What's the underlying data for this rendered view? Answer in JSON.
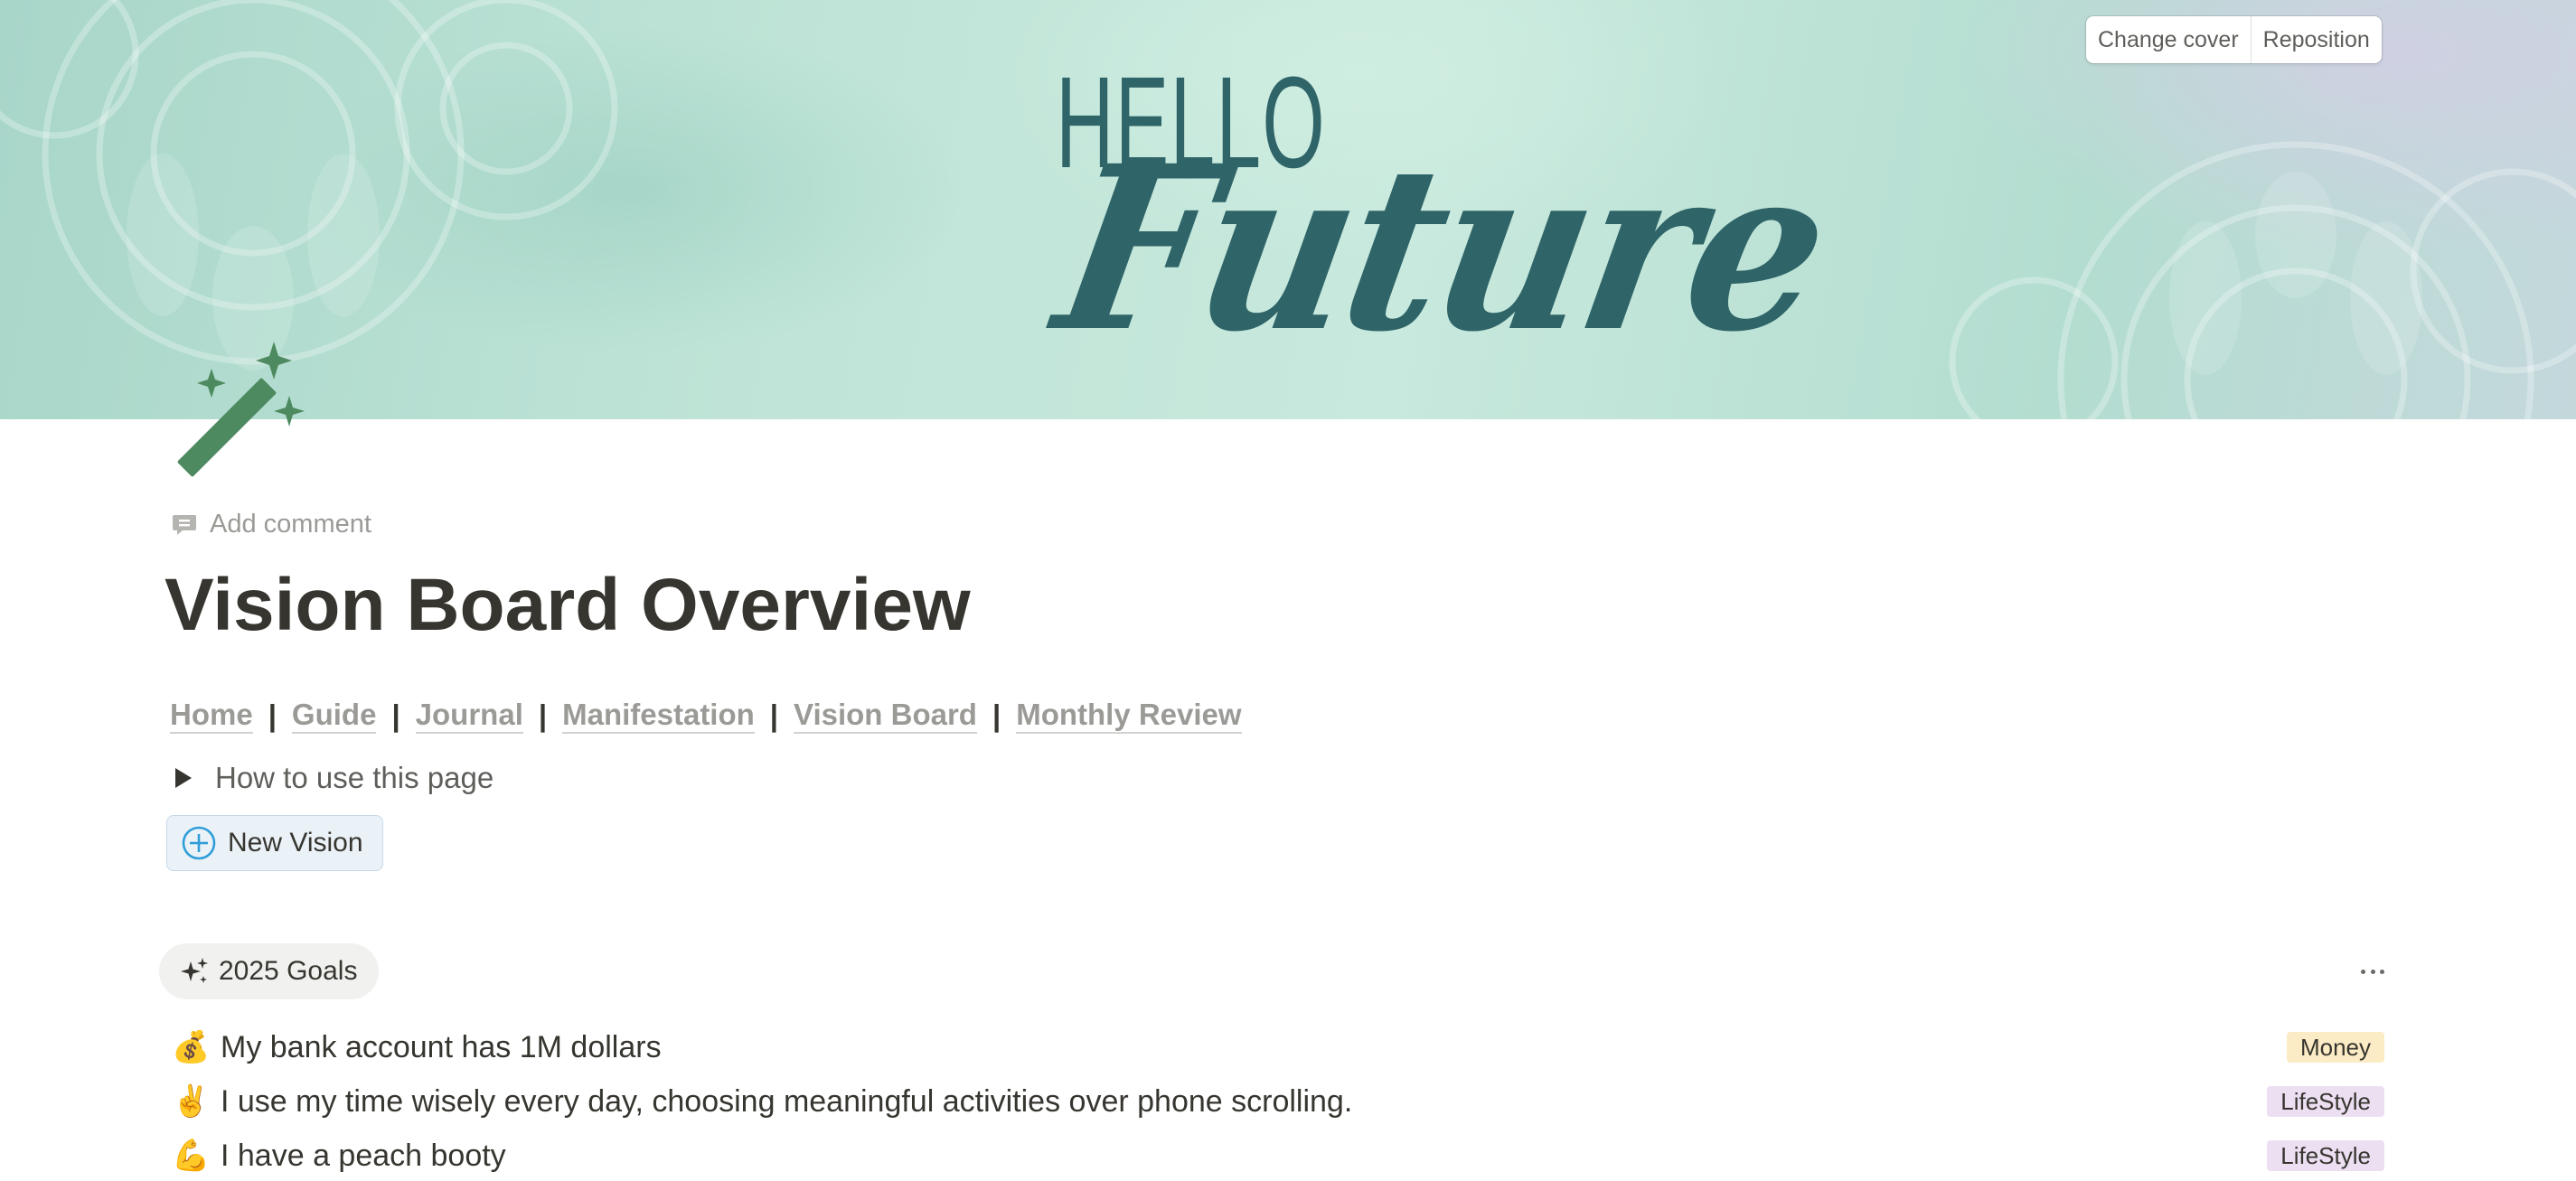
{
  "cover": {
    "hello_text": "HELLO",
    "future_text": "Future",
    "change_cover_label": "Change cover",
    "reposition_label": "Reposition"
  },
  "page": {
    "icon": "magic-wand-sparkles-icon",
    "add_comment_label": "Add comment",
    "title": "Vision Board Overview"
  },
  "nav": {
    "items": [
      "Home",
      "Guide",
      "Journal",
      "Manifestation",
      "Vision Board",
      "Monthly Review"
    ],
    "separator": "|"
  },
  "toggle": {
    "label": "How to use this page"
  },
  "new_vision": {
    "label": "New Vision",
    "icon": "plus-circle-icon"
  },
  "goals_view": {
    "tab_label": "2025 Goals",
    "tab_icon": "sparkles-icon",
    "more_icon": "more-horizontal-icon",
    "items": [
      {
        "emoji": "💰",
        "text": "My bank account has 1M dollars",
        "tag": "Money",
        "tag_color": "#fbecc6"
      },
      {
        "emoji": "✌️",
        "text": "I use my time wisely every day, choosing meaningful activities over phone scrolling.",
        "tag": "LifeStyle",
        "tag_color": "#ecdff2"
      },
      {
        "emoji": "💪",
        "text": "I have a peach booty",
        "tag": "LifeStyle",
        "tag_color": "#ecdff2"
      }
    ]
  },
  "colors": {
    "accent_blue": "#2f9ed8",
    "title_text": "#37352f",
    "cover_lettering": "#2f6468",
    "icon_green": "#4e8a5f"
  }
}
